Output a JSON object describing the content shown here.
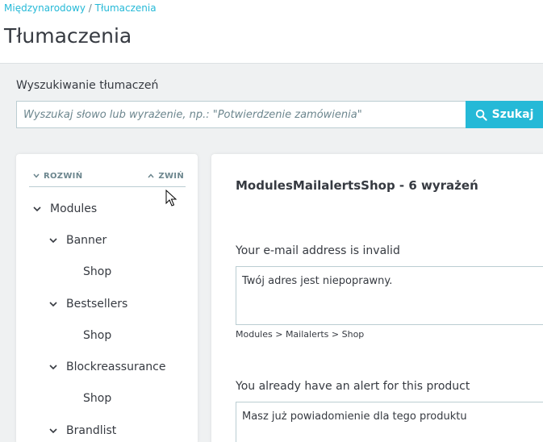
{
  "breadcrumb": {
    "parent": "Międzynarodowy",
    "separator": "/",
    "current": "Tłumaczenia"
  },
  "page": {
    "title": "Tłumaczenia"
  },
  "search": {
    "label": "Wyszukiwanie tłumaczeń",
    "placeholder": "Wyszukaj słowo lub wyrażenie, np.: \"Potwierdzenie zamówienia\"",
    "value": "",
    "button_label": "Szukaj",
    "button_icon": "search-icon"
  },
  "tree": {
    "expand_label": "ROZWIŃ",
    "collapse_label": "ZWIŃ",
    "items": [
      {
        "label": "Modules",
        "level": 0,
        "expanded": true
      },
      {
        "label": "Banner",
        "level": 1,
        "expanded": true
      },
      {
        "label": "Shop",
        "level": 2
      },
      {
        "label": "Bestsellers",
        "level": 1,
        "expanded": true
      },
      {
        "label": "Shop",
        "level": 2
      },
      {
        "label": "Blockreassurance",
        "level": 1,
        "expanded": true
      },
      {
        "label": "Shop",
        "level": 2
      },
      {
        "label": "Brandlist",
        "level": 1,
        "expanded": true
      }
    ]
  },
  "content": {
    "domain_title": "ModulesMailalertsShop - 6 wyrażeń",
    "terms": [
      {
        "original": "Your e-mail address is invalid",
        "translation": "Twój adres jest niepoprawny.",
        "path": "Modules > Mailalerts > Shop"
      },
      {
        "original": "You already have an alert for this product",
        "translation": "Masz już powiadomienie dla tego produktu"
      }
    ]
  },
  "colors": {
    "accent": "#25b9d7",
    "text": "#363a41",
    "muted": "#6c868e",
    "border": "#bbcdd2",
    "background": "#eff1f2"
  }
}
